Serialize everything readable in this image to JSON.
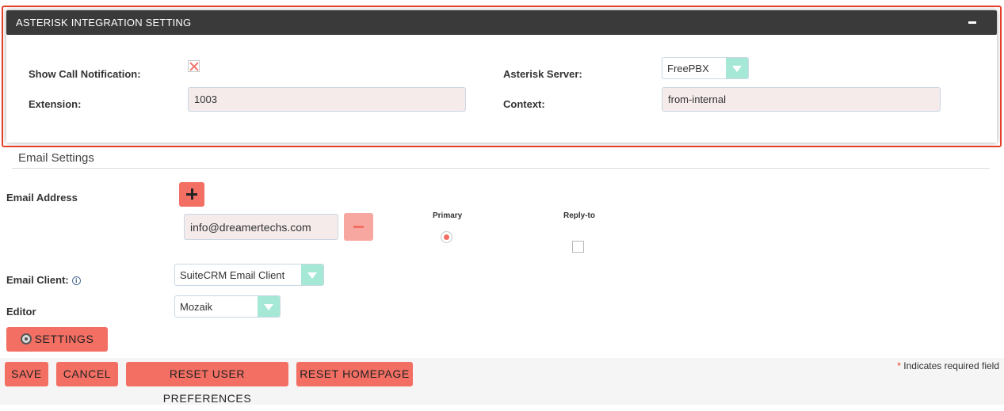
{
  "asterisk_panel": {
    "title": "ASTERISK INTEGRATION SETTING",
    "show_call_notification_label": "Show Call Notification:",
    "asterisk_server_label": "Asterisk Server:",
    "asterisk_server_value": "FreePBX",
    "extension_label": "Extension:",
    "extension_value": "1003",
    "context_label": "Context:",
    "context_value": "from-internal"
  },
  "email_settings": {
    "section_title": "Email Settings",
    "email_address_label": "Email Address",
    "email_value": "info@dreamertechs.com",
    "primary_label": "Primary",
    "reply_to_label": "Reply-to",
    "email_client_label": "Email Client:",
    "email_client_value": "SuiteCRM Email Client",
    "info_icon_glyph": "i",
    "editor_label": "Editor",
    "editor_value": "Mozaik",
    "settings_button": "SETTINGS"
  },
  "footer": {
    "save": "SAVE",
    "cancel": "CANCEL",
    "reset_prefs": "RESET USER PREFERENCES",
    "reset_homepage": "RESET HOMEPAGE",
    "required_star": "*",
    "required_note": " Indicates required field"
  },
  "colors": {
    "accent": "#f36f63",
    "highlight_border": "#e8402a",
    "header_bg": "#3a3a3a",
    "select_arrow": "#a5e8d6"
  }
}
